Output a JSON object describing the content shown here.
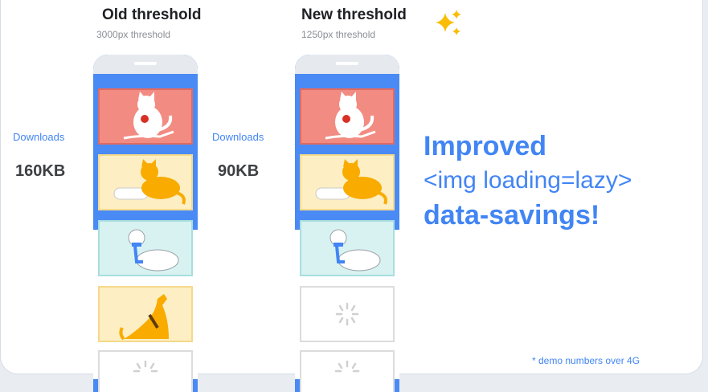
{
  "old": {
    "title": "Old threshold",
    "subtitle": "3000px threshold",
    "downloads_label": "Downloads",
    "downloads_value": "160KB"
  },
  "new": {
    "title": "New threshold",
    "subtitle": "1250px threshold",
    "downloads_label": "Downloads",
    "downloads_value": "90KB"
  },
  "headline": {
    "line1": "Improved",
    "line2": "<img loading=lazy>",
    "line3": "data-savings!"
  },
  "footnote": "* demo numbers over 4G",
  "colors": {
    "accent": "#4285f4",
    "phone": "#4a8af4",
    "tile_red": "#f28b82",
    "tile_yellow": "#fdefc3",
    "tile_teal": "#d8f2f2",
    "sparkle": "#fbbc04"
  },
  "icons": {
    "cat": "cat-icon",
    "cat_lying": "lying-cat-icon",
    "dog_sitting": "sitting-dog-icon",
    "dog_howling": "howling-dog-icon",
    "loading": "loading-spinner-icon",
    "sparkle": "sparkle-icon"
  }
}
